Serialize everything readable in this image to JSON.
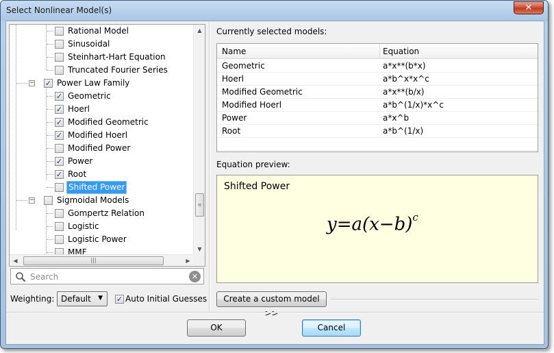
{
  "window": {
    "title": "Select Nonlinear Model(s)",
    "close_glyph": "✕"
  },
  "tree": {
    "items": [
      {
        "label": "Rational Model",
        "checked": false,
        "level": 2
      },
      {
        "label": "Sinusoidal",
        "checked": false,
        "level": 2
      },
      {
        "label": "Steinhart-Hart Equation",
        "checked": false,
        "level": 2
      },
      {
        "label": "Truncated Fourier Series",
        "checked": false,
        "level": 2
      },
      {
        "label": "Power Law Family",
        "checked": true,
        "level": 1,
        "expander": "−"
      },
      {
        "label": "Geometric",
        "checked": true,
        "level": 2
      },
      {
        "label": "Hoerl",
        "checked": true,
        "level": 2
      },
      {
        "label": "Modified Geometric",
        "checked": true,
        "level": 2
      },
      {
        "label": "Modified Hoerl",
        "checked": true,
        "level": 2
      },
      {
        "label": "Modified Power",
        "checked": false,
        "level": 2
      },
      {
        "label": "Power",
        "checked": true,
        "level": 2
      },
      {
        "label": "Root",
        "checked": true,
        "level": 2
      },
      {
        "label": "Shifted Power",
        "checked": false,
        "level": 2,
        "selected": true
      },
      {
        "label": "Sigmoidal Models",
        "checked": false,
        "level": 1,
        "expander": "−"
      },
      {
        "label": "Gompertz Relation",
        "checked": false,
        "level": 2
      },
      {
        "label": "Logistic",
        "checked": false,
        "level": 2
      },
      {
        "label": "Logistic Power",
        "checked": false,
        "level": 2
      },
      {
        "label": "MMF",
        "checked": false,
        "level": 2
      }
    ],
    "scroll_up": "▲",
    "scroll_down": "▼",
    "scroll_left": "◀",
    "scroll_right": "▶",
    "thumb_grip_v": "≡",
    "thumb_grip_h": "|||"
  },
  "search": {
    "placeholder": "Search",
    "value": "",
    "clear_glyph": "✕"
  },
  "weighting": {
    "label": "Weighting:",
    "value": "Default",
    "arrow": "▼"
  },
  "auto_guess": {
    "label": "Auto Initial Guesses",
    "checked": true
  },
  "selected_models": {
    "heading": "Currently selected models:",
    "columns": {
      "name": "Name",
      "equation": "Equation"
    },
    "rows": [
      {
        "name": "Geometric",
        "equation": "a*x**(b*x)"
      },
      {
        "name": "Hoerl",
        "equation": "a*b^x*x^c"
      },
      {
        "name": "Modified Geometric",
        "equation": "a*x**(b/x)"
      },
      {
        "name": "Modified Hoerl",
        "equation": "a*b^(1/x)*x^c"
      },
      {
        "name": "Power",
        "equation": "a*x^b"
      },
      {
        "name": "Root",
        "equation": "a*b^(1/x)"
      }
    ]
  },
  "preview": {
    "label": "Equation preview:",
    "title": "Shifted Power",
    "equation_main": "y=a(x−b)",
    "equation_exp": "c"
  },
  "buttons": {
    "custom": "Create a custom model >>",
    "ok": "OK",
    "cancel": "Cancel"
  },
  "check_glyph": "✓"
}
